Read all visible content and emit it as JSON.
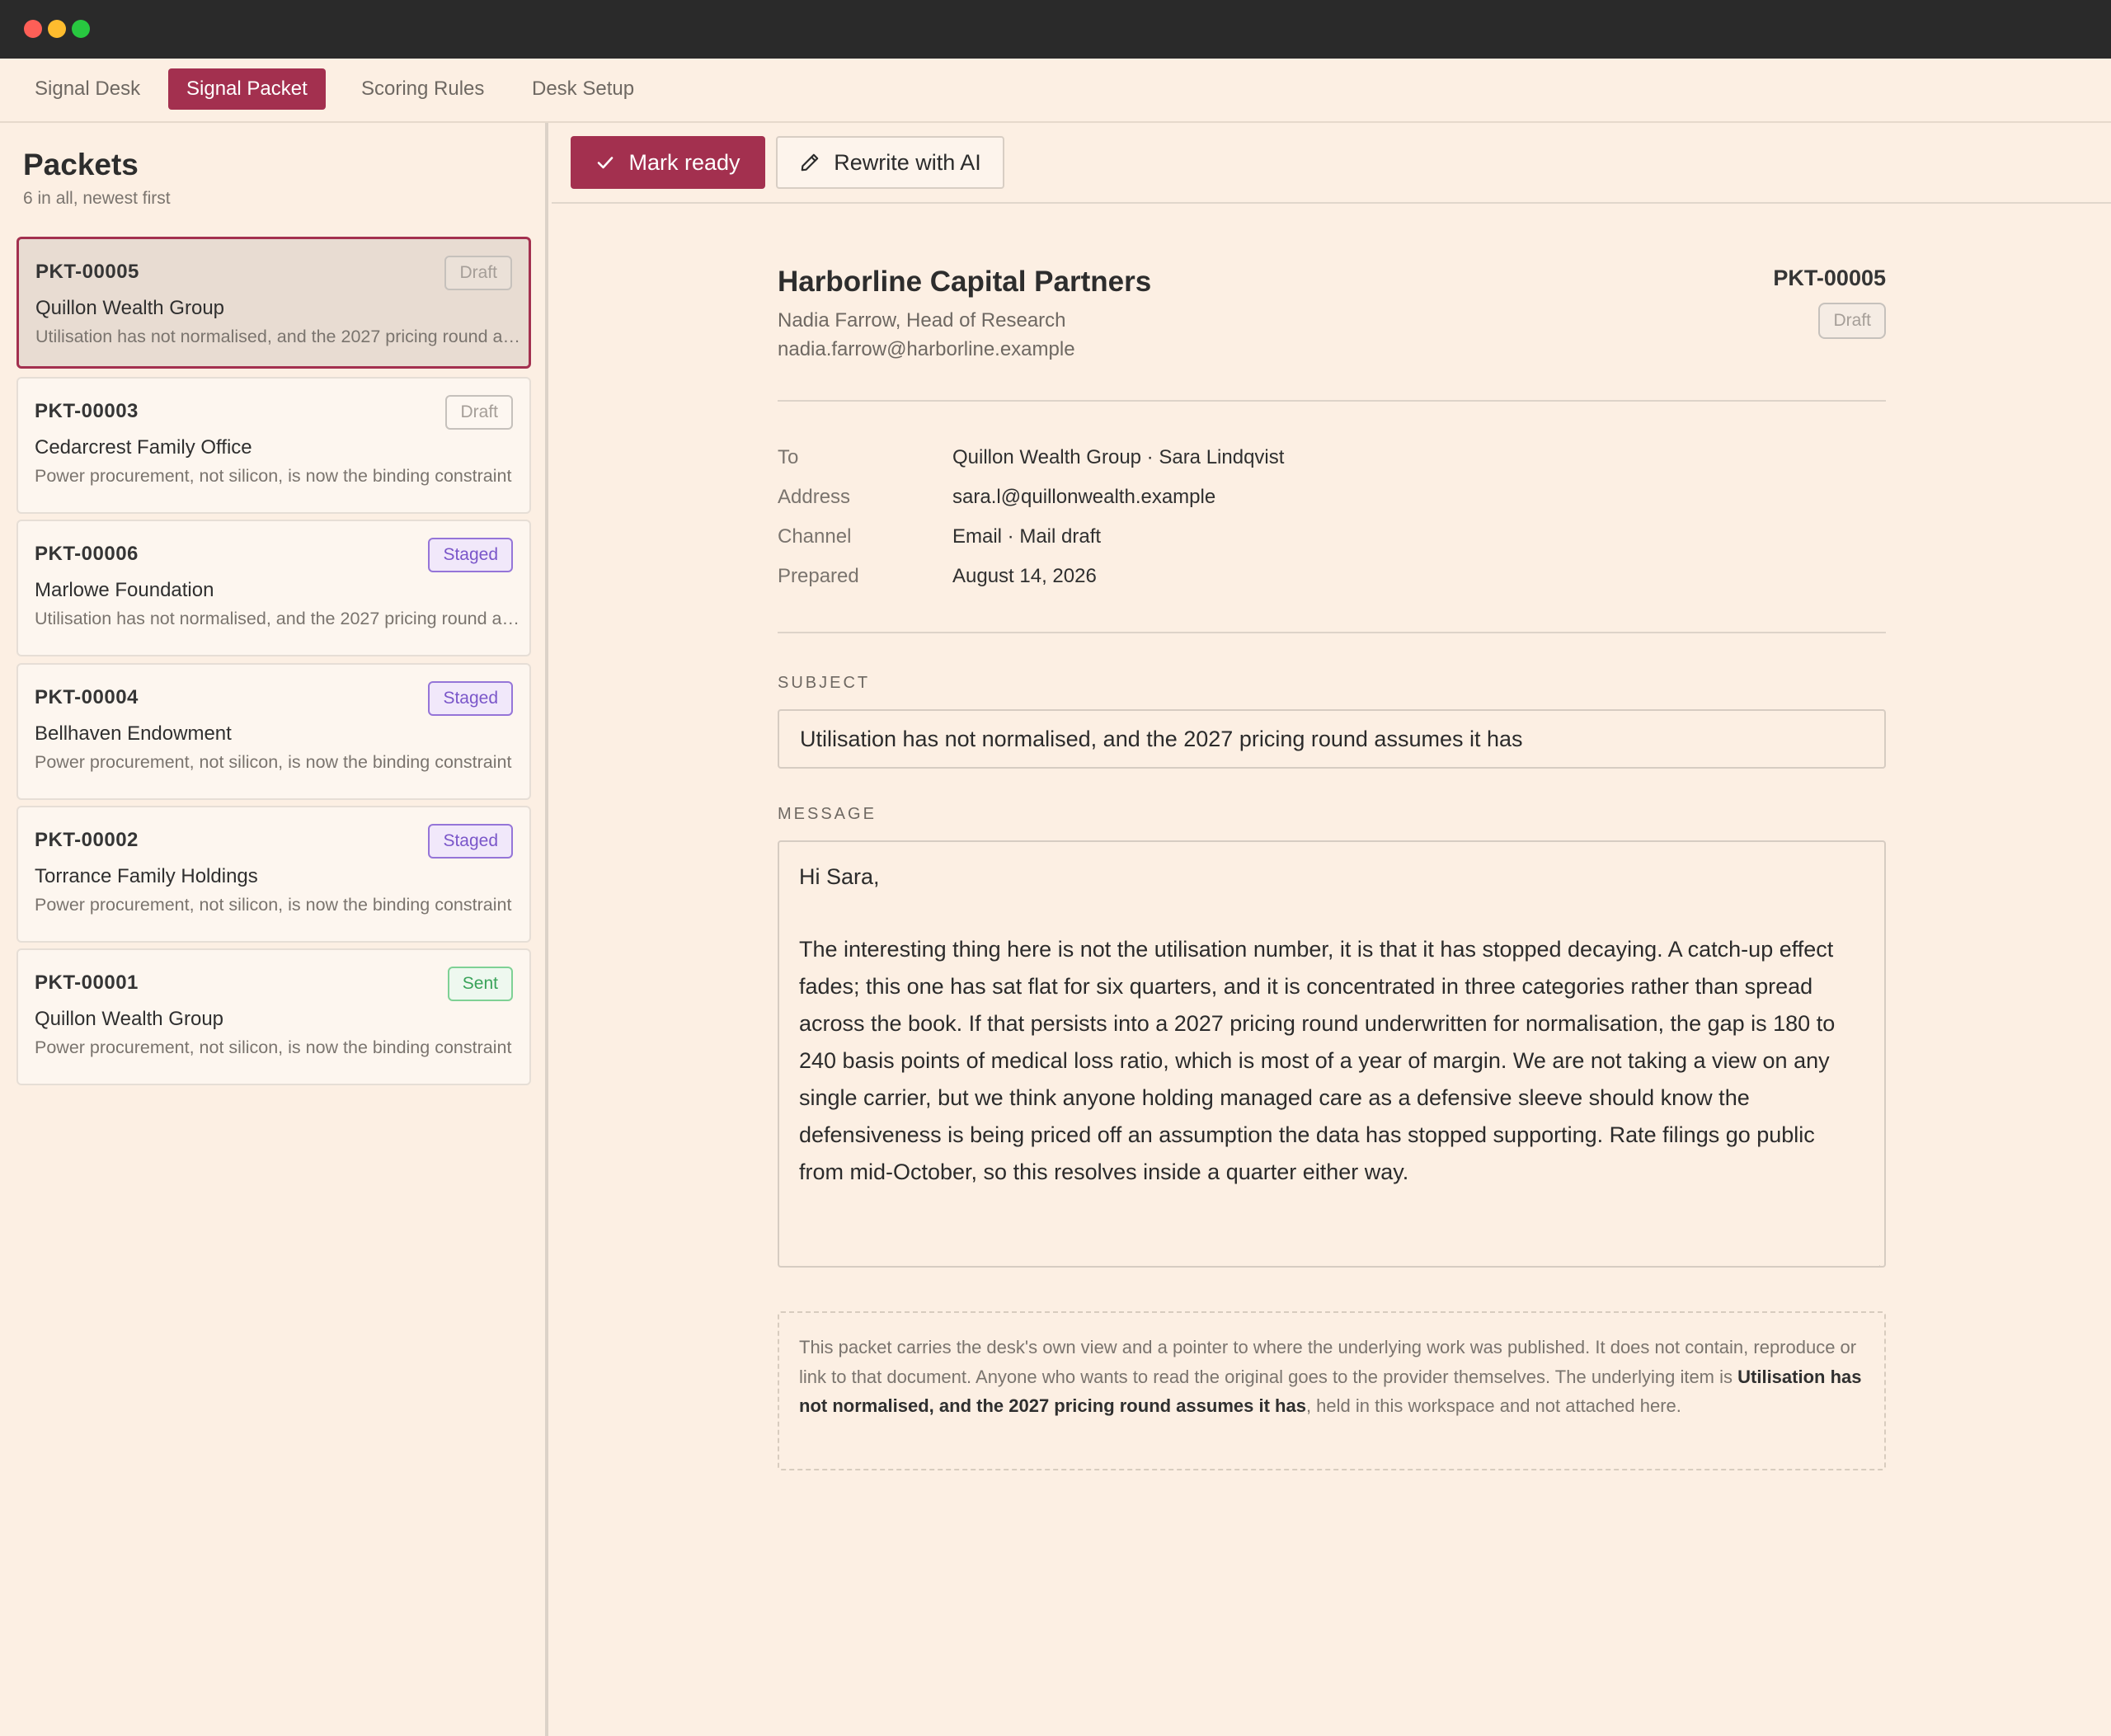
{
  "tabs": [
    {
      "label": "Signal Desk",
      "active": false
    },
    {
      "label": "Signal Packet",
      "active": true
    },
    {
      "label": "Scoring Rules",
      "active": false
    },
    {
      "label": "Desk Setup",
      "active": false
    }
  ],
  "sidebar": {
    "title": "Packets",
    "subtitle": "6 in all, newest first",
    "packets": [
      {
        "id": "PKT-00005",
        "status": "Draft",
        "name": "Quillon Wealth Group",
        "snippet": "Utilisation has not normalised, and the 2027 pricing round assumes it has",
        "selected": true
      },
      {
        "id": "PKT-00003",
        "status": "Draft",
        "name": "Cedarcrest Family Office",
        "snippet": "Power procurement, not silicon, is now the binding constraint",
        "selected": false
      },
      {
        "id": "PKT-00006",
        "status": "Staged",
        "name": "Marlowe Foundation",
        "snippet": "Utilisation has not normalised, and the 2027 pricing round assumes it has",
        "selected": false
      },
      {
        "id": "PKT-00004",
        "status": "Staged",
        "name": "Bellhaven Endowment",
        "snippet": "Power procurement, not silicon, is now the binding constraint",
        "selected": false
      },
      {
        "id": "PKT-00002",
        "status": "Staged",
        "name": "Torrance Family Holdings",
        "snippet": "Power procurement, not silicon, is now the binding constraint",
        "selected": false
      },
      {
        "id": "PKT-00001",
        "status": "Sent",
        "name": "Quillon Wealth Group",
        "snippet": "Power procurement, not silicon, is now the binding constraint",
        "selected": false
      }
    ]
  },
  "toolbar": {
    "mark_ready_label": "Mark ready",
    "mark_ready_icon": "check-icon",
    "rewrite_label": "Rewrite with AI",
    "rewrite_icon": "pencil-icon"
  },
  "packet": {
    "company": "Harborline Capital Partners",
    "contact_name": "Nadia Farrow, Head of Research",
    "contact_email": "nadia.farrow@harborline.example",
    "id": "PKT-00005",
    "status": "Draft",
    "meta": [
      {
        "label": "To",
        "value": "Quillon Wealth Group · Sara Lindqvist"
      },
      {
        "label": "Address",
        "value": "sara.l@quillonwealth.example"
      },
      {
        "label": "Channel",
        "value": "Email · Mail draft"
      },
      {
        "label": "Prepared",
        "value": "August 14, 2026"
      }
    ],
    "subject_label": "SUBJECT",
    "subject": "Utilisation has not normalised, and the 2027 pricing round assumes it has",
    "message_label": "MESSAGE",
    "message_greeting": "Hi Sara,",
    "message_body": "The interesting thing here is not the utilisation number, it is that it has stopped decaying. A catch-up effect fades; this one has sat flat for six quarters, and it is concentrated in three categories rather than spread across the book. If that persists into a 2027 pricing round underwritten for normalisation, the gap is 180 to 240 basis points of medical loss ratio, which is most of a year of margin. We are not taking a view on any single carrier, but we think anyone holding managed care as a defensive sleeve should know the defensiveness is being priced off an assumption the data has stopped supporting. Rate filings go public from mid-October, so this resolves inside a quarter either way.",
    "note_prefix": "This packet carries the desk's own view and a pointer to where the underlying work was published. It does not contain, reproduce or link to that document. Anyone who wants to read the original goes to the provider themselves. The underlying item is ",
    "note_item": "Utilisation has not normalised, and the 2027 pricing round assumes it has",
    "note_suffix": ", held in this workspace and not attached here."
  },
  "colors": {
    "accent": "#a3304f",
    "background": "#fcefe3",
    "titlebar": "#2a2a2a",
    "draft": "#a59e98",
    "staged": "#7a56c9",
    "sent": "#3aa35a"
  }
}
